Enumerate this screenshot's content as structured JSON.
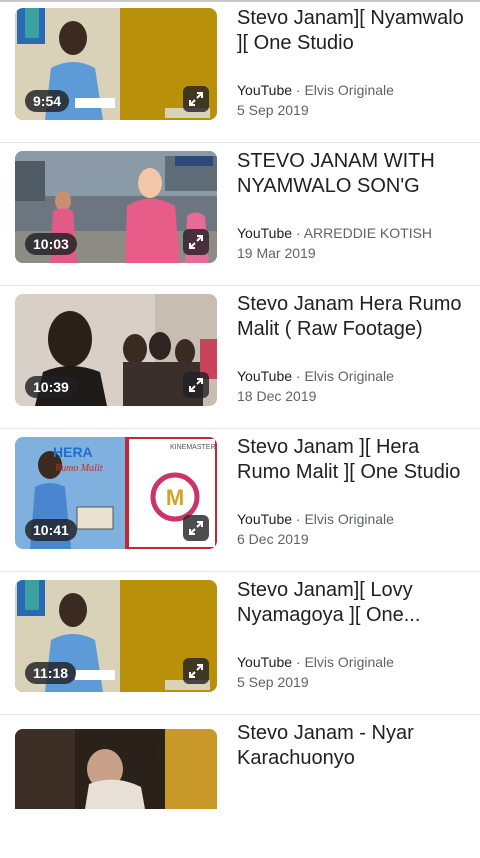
{
  "results": [
    {
      "duration": "9:54",
      "title": "Stevo Janam][ Nyamwalo ][ One Studio",
      "source": "YouTube",
      "channel": "Elvis Originale",
      "date": "5 Sep 2019",
      "thumb": "poster-yellow"
    },
    {
      "duration": "10:03",
      "title": "STEVO JANAM WITH NYAMWALO SON'G",
      "source": "YouTube",
      "channel": "ARREDDIE KOTISH",
      "date": "19 Mar 2019",
      "thumb": "street-dancers"
    },
    {
      "duration": "10:39",
      "title": "Stevo Janam Hera Rumo Malit ( Raw Footage)",
      "source": "YouTube",
      "channel": "Elvis Originale",
      "date": "18 Dec 2019",
      "thumb": "room-group"
    },
    {
      "duration": "10:41",
      "title": "Stevo Janam ][ Hera Rumo Malit ][ One Studio",
      "source": "YouTube",
      "channel": "Elvis Originale",
      "date": "6 Dec 2019",
      "thumb": "poster-hera"
    },
    {
      "duration": "11:18",
      "title": "Stevo Janam][ Lovy Nyamagoya ][ One...",
      "source": "YouTube",
      "channel": "Elvis Originale",
      "date": "5 Sep 2019",
      "thumb": "poster-yellow"
    },
    {
      "duration": "",
      "title": "Stevo Janam - Nyar Karachuonyo",
      "source": "",
      "channel": "",
      "date": "",
      "thumb": "dark-scene"
    }
  ],
  "meta_separator": " · ",
  "thumb_texts": {
    "poster_hera_title": "HERA",
    "poster_hera_sub": "Rumo Malit",
    "kinemaster": "KINEMASTER"
  },
  "icons": {
    "expand": "expand-icon"
  },
  "colors": {
    "duration_bg": "#202124",
    "meta": "#5f6368",
    "title": "#202124"
  }
}
